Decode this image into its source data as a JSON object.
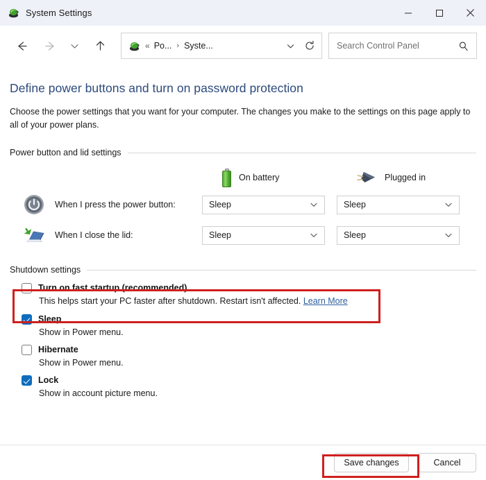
{
  "window": {
    "title": "System Settings",
    "app_icon": "power-options-icon",
    "controls": {
      "minimize": "minimize-icon",
      "maximize": "maximize-icon",
      "close": "close-icon"
    }
  },
  "navbar": {
    "back": "back-arrow-icon",
    "forward": "forward-arrow-icon",
    "recent": "recent-locations-icon",
    "up": "up-arrow-icon",
    "address": {
      "icon": "power-options-icon",
      "overflow": "«",
      "crumbs": [
        "Po...",
        "Syste..."
      ],
      "separator": "›",
      "dropdown": "chevron-down-icon",
      "refresh": "refresh-icon"
    },
    "search": {
      "placeholder": "Search Control Panel",
      "icon": "search-icon"
    }
  },
  "page": {
    "title": "Define power buttons and turn on password protection",
    "description": "Choose the power settings that you want for your computer. The changes you make to the settings on this page apply to all of your power plans."
  },
  "power_section": {
    "heading": "Power button and lid settings",
    "columns": [
      {
        "label": "On battery",
        "icon": "battery-icon"
      },
      {
        "label": "Plugged in",
        "icon": "power-plug-icon"
      }
    ],
    "rows": [
      {
        "icon": "power-button-icon",
        "label": "When I press the power button:",
        "on_battery": "Sleep",
        "plugged_in": "Sleep"
      },
      {
        "icon": "laptop-lid-icon",
        "label": "When I close the lid:",
        "on_battery": "Sleep",
        "plugged_in": "Sleep"
      }
    ],
    "dropdown_arrow": "chevron-down-icon"
  },
  "shutdown_section": {
    "heading": "Shutdown settings",
    "options": [
      {
        "label": "Turn on fast startup (recommended)",
        "checked": false,
        "description": "This helps start your PC faster after shutdown. Restart isn't affected.",
        "link": "Learn More",
        "highlighted": true
      },
      {
        "label": "Sleep",
        "checked": true,
        "description": "Show in Power menu.",
        "link": "",
        "highlighted": false
      },
      {
        "label": "Hibernate",
        "checked": false,
        "description": "Show in Power menu.",
        "link": "",
        "highlighted": false
      },
      {
        "label": "Lock",
        "checked": true,
        "description": "Show in account picture menu.",
        "link": "",
        "highlighted": false
      }
    ]
  },
  "footer": {
    "save_label": "Save changes",
    "cancel_label": "Cancel",
    "save_highlighted": true
  },
  "colors": {
    "titlebar": "#eef1f8",
    "heading": "#2c4a7c",
    "link": "#2f5f9e",
    "checkbox_checked": "#0f6cbd",
    "annotation": "#cf1f1f",
    "battery_green": "#56b033"
  }
}
